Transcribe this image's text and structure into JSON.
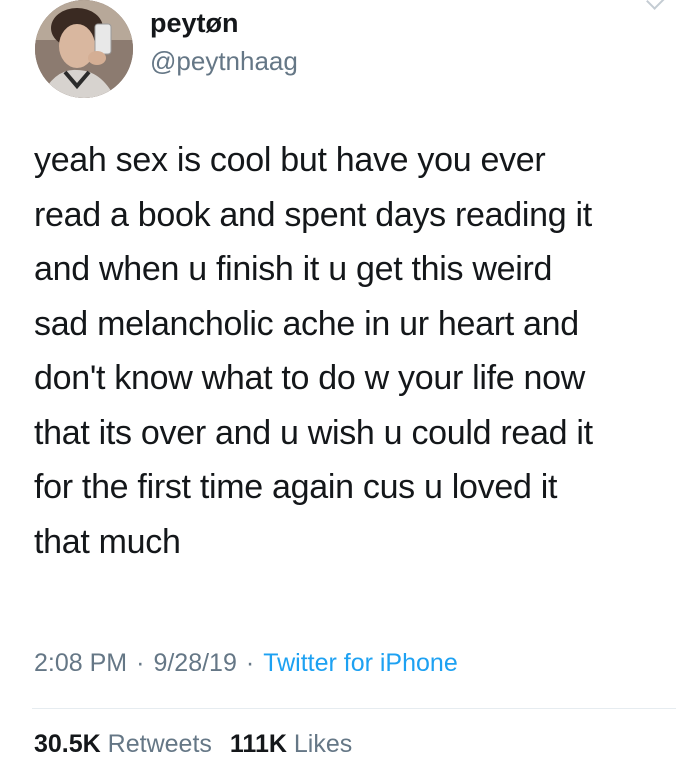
{
  "user": {
    "display_name": "peytøn",
    "handle": "@peytnhaag",
    "avatar_icon": "profile-photo"
  },
  "tweet": {
    "text": "yeah sex is cool but have you ever\nread a book and spent days reading it\nand when u finish it u get this weird\nsad melancholic ache in ur heart and\ndon't know what to do w your life now\nthat its over and u wish u could read it\nfor the first time again cus u loved it\nthat much",
    "time": "2:08 PM",
    "date": "9/28/19",
    "separator": "·",
    "source": "Twitter for iPhone"
  },
  "stats": {
    "retweets_count": "30.5K",
    "retweets_label": "Retweets",
    "likes_count": "111K",
    "likes_label": "Likes"
  },
  "colors": {
    "text": "#14171a",
    "secondary": "#657786",
    "link": "#1da1f2",
    "divider": "#e6ecf0"
  }
}
